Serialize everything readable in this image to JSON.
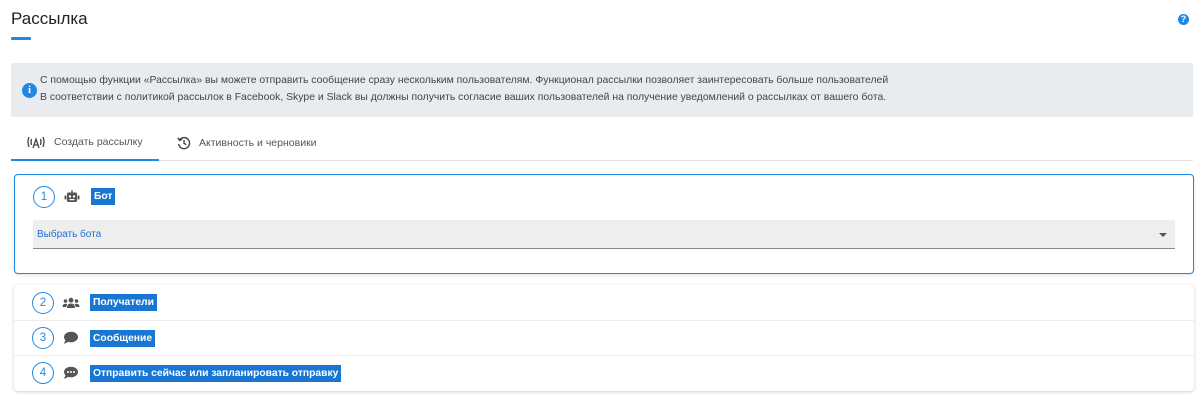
{
  "page": {
    "title": "Рассылка",
    "help_icon": "question-circle-icon",
    "accent_color": "#1e88e5"
  },
  "info": {
    "icon": "info-circle-icon",
    "line1": "С помощью функции «Рассылка» вы можете отправить сообщение сразу нескольким пользователям. Функционал рассылки позволяет заинтересовать больше пользователей",
    "line2": "В соответствии с политикой рассылок в Facebook, Skype и Slack вы должны получить согласие ваших пользователей на получение уведомлений о рассылках от вашего бота."
  },
  "tabs": [
    {
      "label": "Создать рассылку",
      "icon": "broadcast-icon",
      "active": true
    },
    {
      "label": "Активность и черновики",
      "icon": "history-icon",
      "active": false
    }
  ],
  "steps": [
    {
      "number": "1",
      "icon": "robot-icon",
      "label": "Бот"
    },
    {
      "number": "2",
      "icon": "users-icon",
      "label": "Получатели"
    },
    {
      "number": "3",
      "icon": "comment-icon",
      "label": "Сообщение"
    },
    {
      "number": "4",
      "icon": "comment-dots-icon",
      "label": "Отправить сейчас или запланировать отправку"
    }
  ],
  "bot_select": {
    "value": "Выбрать бота"
  }
}
